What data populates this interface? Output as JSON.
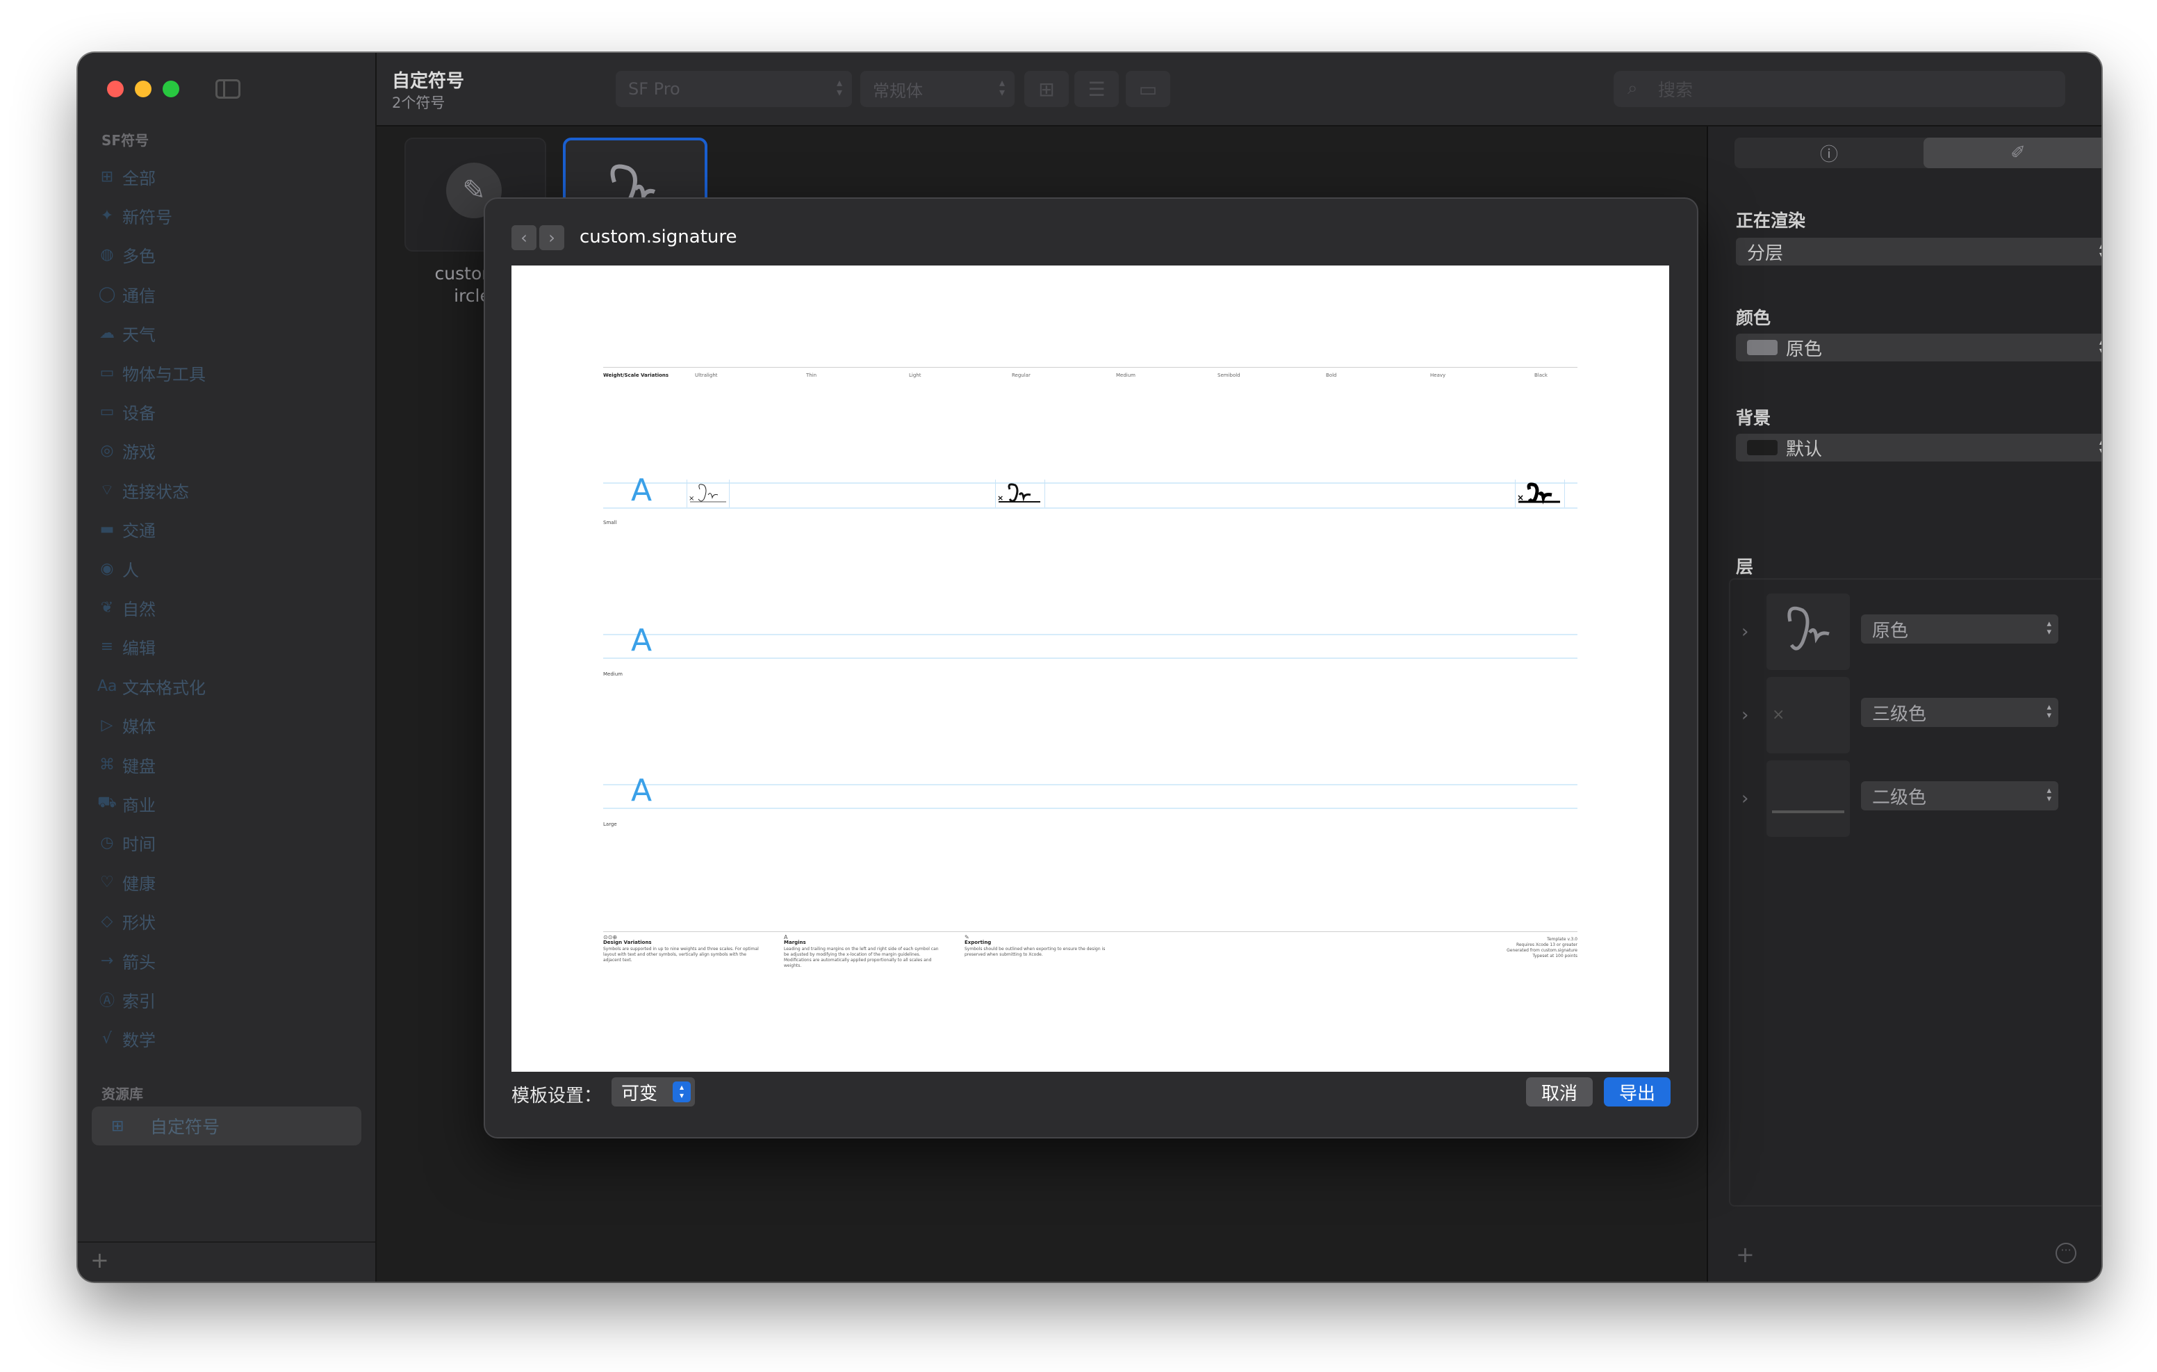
{
  "toolbar": {
    "title": "自定符号",
    "subtitle": "2个符号",
    "font_popup": "SF Pro",
    "weight_popup": "常规体",
    "search_placeholder": "搜索"
  },
  "sidebar": {
    "section_symbols": "SF符号",
    "items": [
      {
        "label": "全部",
        "icon": "grid-icon"
      },
      {
        "label": "新符号",
        "icon": "sparkle-icon"
      },
      {
        "label": "多色",
        "icon": "palette-icon"
      },
      {
        "label": "通信",
        "icon": "bubble-icon"
      },
      {
        "label": "天气",
        "icon": "cloud-sun-icon"
      },
      {
        "label": "物体与工具",
        "icon": "folder-icon"
      },
      {
        "label": "设备",
        "icon": "desktop-icon"
      },
      {
        "label": "游戏",
        "icon": "gamecontroller-icon"
      },
      {
        "label": "连接状态",
        "icon": "antenna-icon"
      },
      {
        "label": "交通",
        "icon": "car-icon"
      },
      {
        "label": "人",
        "icon": "person-icon"
      },
      {
        "label": "自然",
        "icon": "leaf-icon"
      },
      {
        "label": "编辑",
        "icon": "slider-icon"
      },
      {
        "label": "文本格式化",
        "icon": "textformat-icon"
      },
      {
        "label": "媒体",
        "icon": "playpause-icon"
      },
      {
        "label": "键盘",
        "icon": "command-icon"
      },
      {
        "label": "商业",
        "icon": "cart-icon"
      },
      {
        "label": "时间",
        "icon": "clock-icon"
      },
      {
        "label": "健康",
        "icon": "heart-icon"
      },
      {
        "label": "形状",
        "icon": "shapes-icon"
      },
      {
        "label": "箭头",
        "icon": "arrow-right-icon"
      },
      {
        "label": "索引",
        "icon": "a-circle-icon"
      },
      {
        "label": "数学",
        "icon": "function-icon"
      }
    ],
    "section_library": "资源库",
    "library_item": "自定符号"
  },
  "main": {
    "tile_label": "custom.p\nircle."
  },
  "inspector": {
    "rendering_label": "正在渲染",
    "rendering_value": "分层",
    "color_label": "颜色",
    "color_value": "原色",
    "background_label": "背景",
    "background_value": "默认",
    "layers_label": "层",
    "layers": [
      {
        "value": "原色"
      },
      {
        "value": "三级色"
      },
      {
        "value": "二级色"
      }
    ]
  },
  "dialog": {
    "title": "custom.signature",
    "template_label": "模板设置：",
    "template_value": "可变",
    "cancel": "取消",
    "export": "导出",
    "template": {
      "header_first": "Weight/Scale Variations",
      "weights": [
        "Ultralight",
        "Thin",
        "Light",
        "Regular",
        "Medium",
        "Semibold",
        "Bold",
        "Heavy",
        "Black"
      ],
      "scale_labels": [
        "Small",
        "Medium",
        "Large"
      ],
      "foot_design_title": "Design Variations",
      "foot_design_text": "Symbols are supported in up to nine weights and three scales. For optimal layout with text and other symbols, vertically align symbols with the adjacent text.",
      "foot_margins_title": "Margins",
      "foot_margins_text": "Leading and trailing margins on the left and right side of each symbol can be adjusted by modifying the x-location of the margin guidelines. Modifications are automatically applied proportionally to all scales and weights.",
      "foot_export_title": "Exporting",
      "foot_export_text": "Symbols should be outlined when exporting to ensure the design is preserved when submitting to Xcode.",
      "foot_right_text": "Template v.3.0\nRequires Xcode 13 or greater\nGenerated from custom.signature\nTypeset at 100 points"
    }
  },
  "colors": {
    "accent": "#1f6fe0",
    "guide": "#3aa0e8",
    "close": "#ff5f57",
    "minimize": "#febc2e",
    "zoom": "#28c840"
  }
}
